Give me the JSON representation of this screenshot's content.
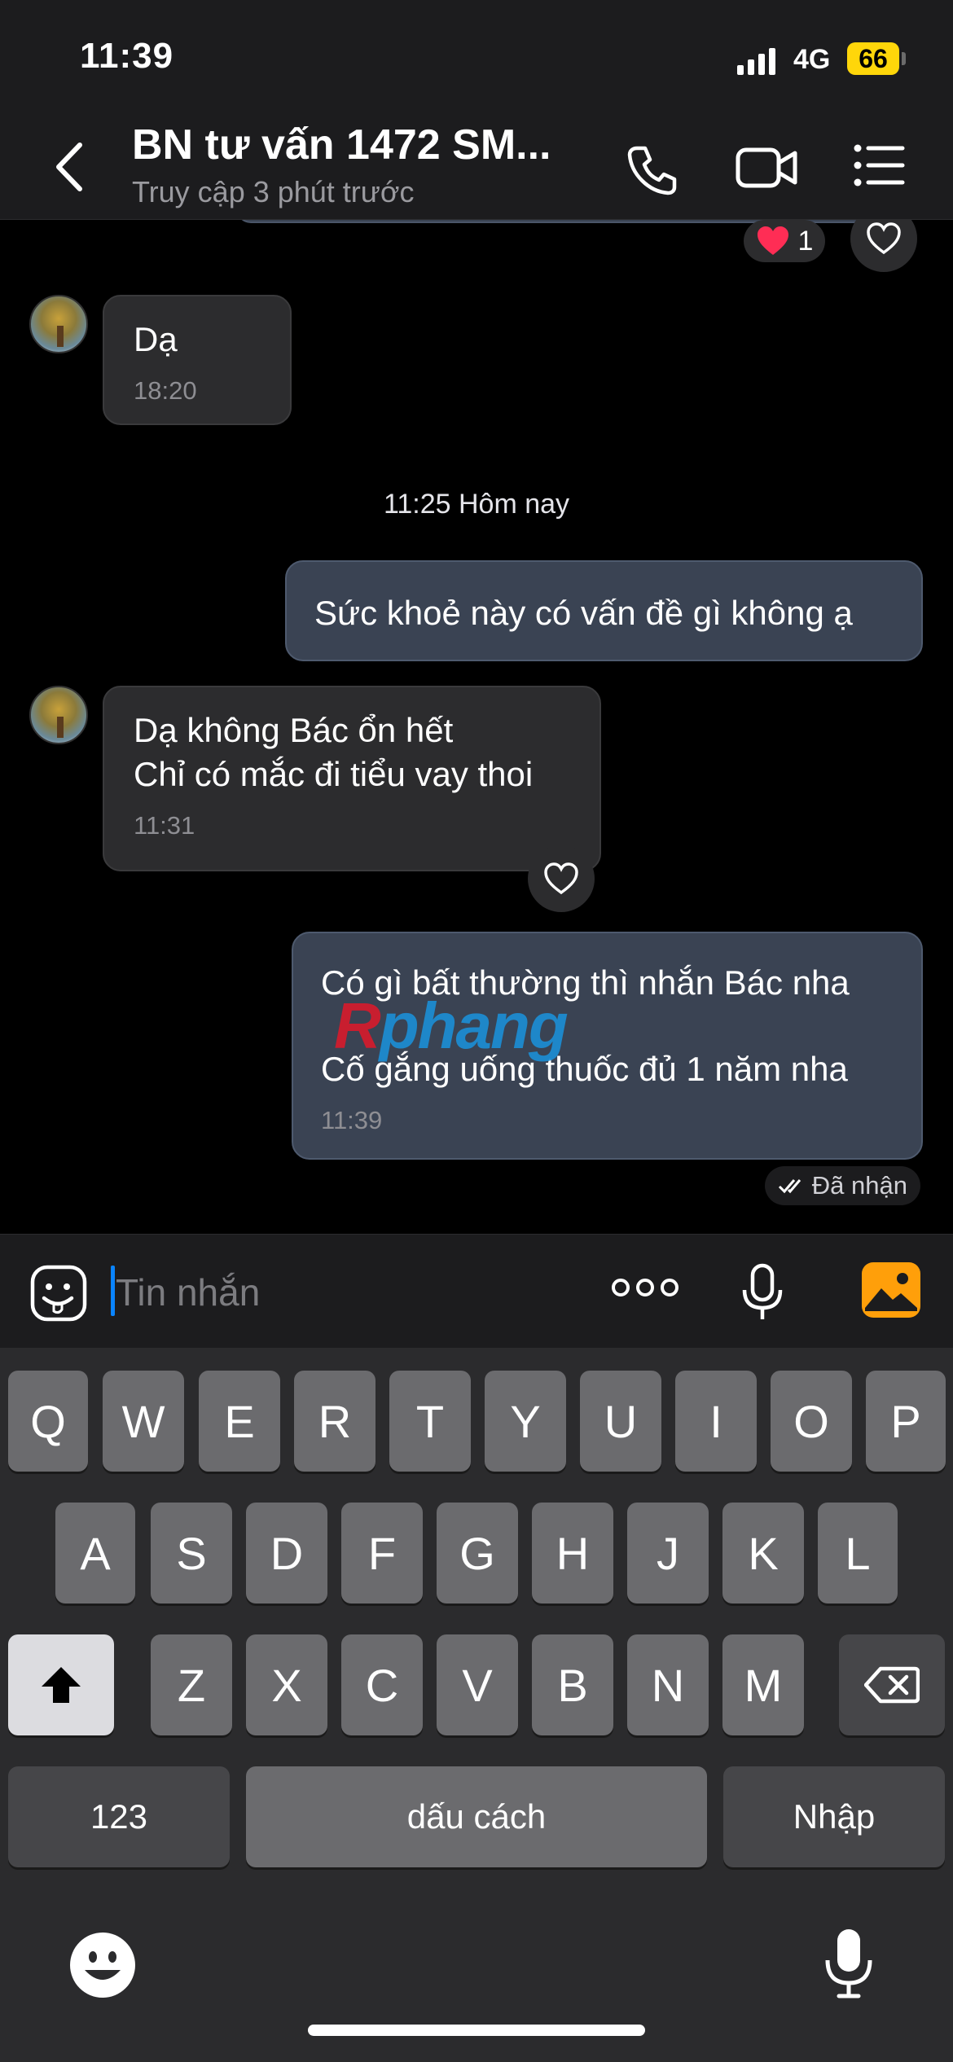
{
  "status": {
    "time": "11:39",
    "network": "4G",
    "battery": "66"
  },
  "header": {
    "title": "BN tư vấn 1472 SM...",
    "subtitle": "Truy cập 3 phút trước",
    "icons": [
      "back-chevron-icon",
      "phone-icon",
      "video-camera-icon",
      "menu-list-icon"
    ]
  },
  "chat": {
    "prev_reaction": {
      "emoji": "heart",
      "count": "1"
    },
    "messages": [
      {
        "side": "in",
        "lines": [
          "Dạ"
        ],
        "time": "18:20"
      },
      {
        "side": "out",
        "lines": [
          "Sức khoẻ này có vấn đề gì không ạ"
        ]
      },
      {
        "side": "in",
        "lines": [
          "Dạ không Bác ổn hết",
          "Chỉ có mắc đi tiểu vay thoi"
        ],
        "time": "11:31"
      },
      {
        "side": "out",
        "lines": [
          "Có gì bất thường thì nhắn Bác nha",
          "Cố gắng uống thuốc đủ 1 năm nha"
        ],
        "time": "11:39"
      }
    ],
    "day_separator": "11:25 Hôm nay",
    "delivery_status": "Đã nhận",
    "watermark": {
      "r": "R",
      "rest": "phang"
    }
  },
  "input": {
    "placeholder": "Tin nhắn"
  },
  "keyboard": {
    "row1": [
      "Q",
      "W",
      "E",
      "R",
      "T",
      "Y",
      "U",
      "I",
      "O",
      "P"
    ],
    "row2": [
      "A",
      "S",
      "D",
      "F",
      "G",
      "H",
      "J",
      "K",
      "L"
    ],
    "row3": [
      "Z",
      "X",
      "C",
      "V",
      "B",
      "N",
      "M"
    ],
    "numbers": "123",
    "space": "dấu cách",
    "enter": "Nhập"
  },
  "colors": {
    "accent": "#0a84ff",
    "battery": "#ffd60a",
    "media_button": "#ff9f0a",
    "out_bubble": "#3a4353",
    "in_bubble": "#2c2c2e"
  }
}
